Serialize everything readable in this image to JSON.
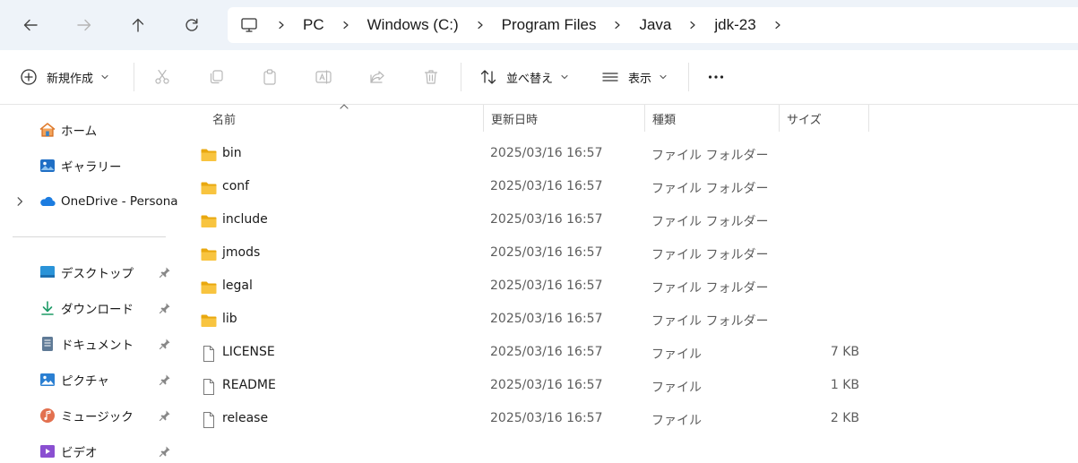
{
  "address_bar": {
    "breadcrumbs": [
      "PC",
      "Windows (C:)",
      "Program Files",
      "Java",
      "jdk-23"
    ]
  },
  "toolbar": {
    "new_label": "新規作成",
    "sort_label": "並べ替え",
    "view_label": "表示"
  },
  "sidebar": {
    "items": [
      {
        "label": "ホーム",
        "icon": "home-icon"
      },
      {
        "label": "ギャラリー",
        "icon": "gallery-icon"
      },
      {
        "label": "OneDrive - Persona",
        "icon": "onedrive-cloud-icon"
      }
    ],
    "pinned": [
      {
        "label": "デスクトップ",
        "icon": "desktop-icon"
      },
      {
        "label": "ダウンロード",
        "icon": "download-icon"
      },
      {
        "label": "ドキュメント",
        "icon": "documents-icon"
      },
      {
        "label": "ピクチャ",
        "icon": "pictures-icon"
      },
      {
        "label": "ミュージック",
        "icon": "music-icon"
      },
      {
        "label": "ビデオ",
        "icon": "video-icon"
      }
    ]
  },
  "file_list": {
    "columns": {
      "name": "名前",
      "modified": "更新日時",
      "type": "種類",
      "size": "サイズ"
    },
    "rows": [
      {
        "name": "bin",
        "modified": "2025/03/16 16:57",
        "type": "ファイル フォルダー",
        "size": "",
        "kind": "folder"
      },
      {
        "name": "conf",
        "modified": "2025/03/16 16:57",
        "type": "ファイル フォルダー",
        "size": "",
        "kind": "folder"
      },
      {
        "name": "include",
        "modified": "2025/03/16 16:57",
        "type": "ファイル フォルダー",
        "size": "",
        "kind": "folder"
      },
      {
        "name": "jmods",
        "modified": "2025/03/16 16:57",
        "type": "ファイル フォルダー",
        "size": "",
        "kind": "folder"
      },
      {
        "name": "legal",
        "modified": "2025/03/16 16:57",
        "type": "ファイル フォルダー",
        "size": "",
        "kind": "folder"
      },
      {
        "name": "lib",
        "modified": "2025/03/16 16:57",
        "type": "ファイル フォルダー",
        "size": "",
        "kind": "folder"
      },
      {
        "name": "LICENSE",
        "modified": "2025/03/16 16:57",
        "type": "ファイル",
        "size": "7 KB",
        "kind": "file"
      },
      {
        "name": "README",
        "modified": "2025/03/16 16:57",
        "type": "ファイル",
        "size": "1 KB",
        "kind": "file"
      },
      {
        "name": "release",
        "modified": "2025/03/16 16:57",
        "type": "ファイル",
        "size": "2 KB",
        "kind": "file"
      }
    ]
  },
  "colors": {
    "address_bg": "#eef3f9",
    "folder_yellow": "#f8c43f",
    "accent_blue": "#0067c0"
  }
}
